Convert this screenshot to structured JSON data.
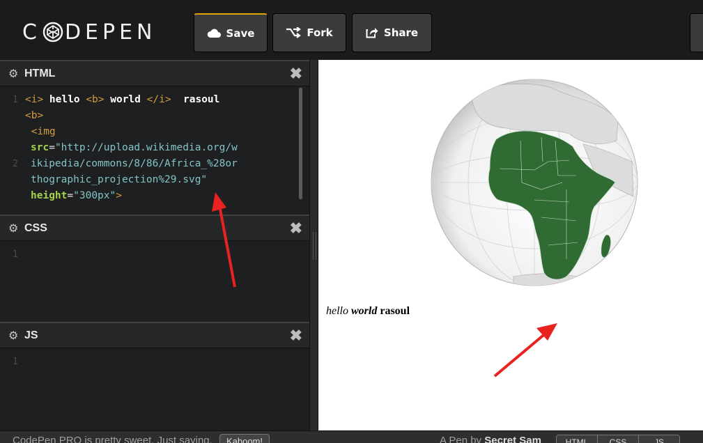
{
  "header": {
    "logo": "C⊛DEPEN",
    "logo_left": "C",
    "logo_right": "DEPEN",
    "buttons": {
      "save": {
        "label": "Save",
        "icon": "cloud-icon"
      },
      "fork": {
        "label": "Fork",
        "icon": "fork-icon"
      },
      "share": {
        "label": "Share",
        "icon": "share-icon"
      }
    }
  },
  "editors": {
    "html": {
      "title": "HTML",
      "gutter": [
        "1",
        "2"
      ],
      "line1": {
        "open_i": "<i>",
        "hello": " hello ",
        "open_b": "<b>",
        "world": " world ",
        "close_i": "</i>",
        "rasoul": "  rasoul"
      },
      "line1b": {
        "open_b2": "<b>"
      },
      "line2": {
        "img_tag": "<img",
        "src_attr": "src",
        "eq1": "=",
        "src_val_1": "\"http://upload.wikimedia.org/w",
        "src_val_2": "ikipedia/commons/8/86/Africa_%28or",
        "src_val_3": "thographic_projection%29.svg\"",
        "height_attr": "height",
        "eq2": "=",
        "height_val": "\"300px\"",
        "close": ">"
      }
    },
    "css": {
      "title": "CSS",
      "gutter": [
        "1"
      ]
    },
    "js": {
      "title": "JS",
      "gutter": [
        "1"
      ]
    }
  },
  "preview": {
    "text_italic": "hello ",
    "text_bold_italic": "world",
    "text_bold": " rasoul"
  },
  "footer": {
    "promo": "CodePen PRO is pretty sweet. Just saying.",
    "promo_button": "Kaboom!",
    "credit_prefix": "A Pen by ",
    "credit_name": "Secret Sam",
    "tabs": [
      "HTML",
      "CSS",
      "JS"
    ]
  },
  "colors": {
    "accent": "#e2a300",
    "africa": "#2f6b32",
    "arrow": "#e8231f",
    "tag": "#d49c3d",
    "attr": "#a7d14a",
    "string": "#84c4c6"
  }
}
